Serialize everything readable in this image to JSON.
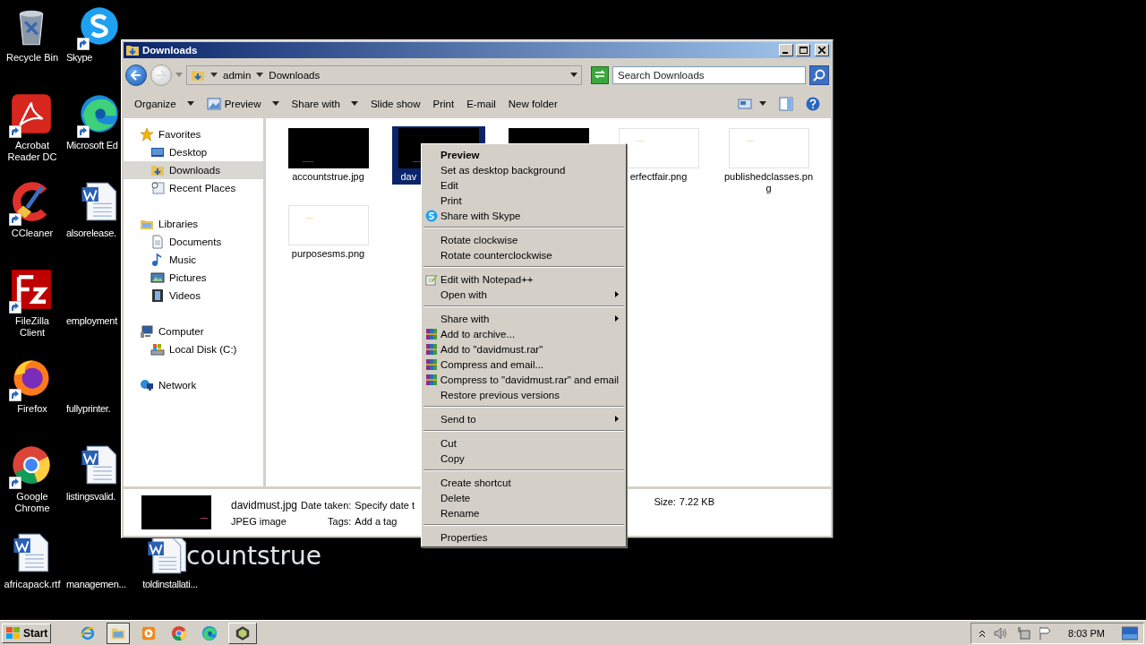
{
  "desktop": {
    "columns": [
      [
        {
          "label": "Recycle Bin",
          "kind": "recycle",
          "shortcut": false
        },
        {
          "label": "Acrobat Reader DC",
          "kind": "acrobat",
          "shortcut": true
        },
        {
          "label": "CCleaner",
          "kind": "ccleaner",
          "shortcut": true
        },
        {
          "label": "FileZilla Client",
          "kind": "filezilla",
          "shortcut": true
        },
        {
          "label": "Firefox",
          "kind": "firefox",
          "shortcut": true
        },
        {
          "label": "Google Chrome",
          "kind": "chrome",
          "shortcut": true
        },
        {
          "label": "africapack.rtf",
          "kind": "word",
          "shortcut": false
        }
      ],
      [
        {
          "label": "Skype",
          "kind": "skype",
          "shortcut": true
        },
        {
          "label": "Microsoft Ed",
          "kind": "edge",
          "shortcut": true
        },
        {
          "label": "alsorelease.",
          "kind": "word",
          "shortcut": false
        },
        {
          "label": "employment",
          "kind": "none",
          "shortcut": false
        },
        {
          "label": "fullyprinter.",
          "kind": "none",
          "shortcut": false
        },
        {
          "label": "listingsvalid.",
          "kind": "word",
          "shortcut": false
        },
        {
          "label": "managemen...",
          "kind": "none",
          "shortcut": false
        }
      ],
      [
        {
          "label": "toldinstallati...",
          "kind": "word",
          "shortcut": false
        }
      ]
    ],
    "drag_ghost": {
      "label": "countstrue",
      "kind": "word"
    }
  },
  "explorer": {
    "title": "Downloads",
    "breadcrumb": [
      "admin",
      "Downloads"
    ],
    "search": {
      "placeholder": "Search Downloads"
    },
    "toolbar": [
      {
        "label": "Organize",
        "kind": "text",
        "dropdown": true
      },
      {
        "label": "Preview",
        "kind": "preview",
        "dropdown": true
      },
      {
        "label": "Share with",
        "kind": "text",
        "dropdown": true
      },
      {
        "label": "Slide show",
        "kind": "text",
        "dropdown": false
      },
      {
        "label": "Print",
        "kind": "text",
        "dropdown": false
      },
      {
        "label": "E-mail",
        "kind": "text",
        "dropdown": false
      },
      {
        "label": "New folder",
        "kind": "text",
        "dropdown": false
      }
    ],
    "nav": [
      {
        "label": "Favorites",
        "kind": "star",
        "children": [
          {
            "label": "Desktop",
            "kind": "desktop",
            "selected": false
          },
          {
            "label": "Downloads",
            "kind": "downloads",
            "selected": true
          },
          {
            "label": "Recent Places",
            "kind": "recent",
            "selected": false
          }
        ]
      },
      {
        "label": "Libraries",
        "kind": "library",
        "children": [
          {
            "label": "Documents",
            "kind": "document",
            "selected": false
          },
          {
            "label": "Music",
            "kind": "music",
            "selected": false
          },
          {
            "label": "Pictures",
            "kind": "pictures",
            "selected": false
          },
          {
            "label": "Videos",
            "kind": "videos",
            "selected": false
          }
        ]
      },
      {
        "label": "Computer",
        "kind": "computer",
        "children": [
          {
            "label": "Local Disk (C:)",
            "kind": "disk",
            "selected": false
          }
        ]
      },
      {
        "label": "Network",
        "kind": "network"
      }
    ],
    "files": [
      {
        "name": "accountstrue.jpg",
        "kind": "dark",
        "selected": false
      },
      {
        "name": "dav",
        "kind": "dark",
        "selected": true
      },
      {
        "kind": "dark",
        "selected": false
      },
      {
        "name": "erfectfair.png",
        "kind": "light",
        "selected": false
      },
      {
        "name": "publishedclasses.png",
        "kind": "light",
        "selected": false
      },
      {
        "name": "purposesms.png",
        "kind": "light",
        "selected": false
      }
    ],
    "details": {
      "name": "davidmust.jpg",
      "type": "JPEG image",
      "date_label": "Date taken:",
      "date_value": "Specify date t",
      "tags_label": "Tags:",
      "tags_value": "Add a tag",
      "size_label": "Size:",
      "size_value": "7.22 KB"
    }
  },
  "context_menu": {
    "groups": [
      [
        {
          "label": "Preview",
          "default": true,
          "kind": "plain",
          "submenu": false
        },
        {
          "label": "Set as desktop background",
          "default": false,
          "kind": "plain",
          "submenu": false
        },
        {
          "label": "Edit",
          "default": false,
          "kind": "plain",
          "submenu": false
        },
        {
          "label": "Print",
          "default": false,
          "kind": "plain",
          "submenu": false
        },
        {
          "label": "Share with Skype",
          "default": false,
          "kind": "skype",
          "submenu": false
        }
      ],
      [
        {
          "label": "Rotate clockwise",
          "default": false,
          "kind": "plain",
          "submenu": false
        },
        {
          "label": "Rotate counterclockwise",
          "default": false,
          "kind": "plain",
          "submenu": false
        }
      ],
      [
        {
          "label": "Edit with Notepad++",
          "default": false,
          "kind": "notepad",
          "submenu": false
        },
        {
          "label": "Open with",
          "default": false,
          "kind": "plain",
          "submenu": true
        }
      ],
      [
        {
          "label": "Share with",
          "default": false,
          "kind": "plain",
          "submenu": true
        },
        {
          "label": "Add to archive...",
          "default": false,
          "kind": "winrar",
          "submenu": false
        },
        {
          "label": "Add to \"davidmust.rar\"",
          "default": false,
          "kind": "winrar",
          "submenu": false
        },
        {
          "label": "Compress and email...",
          "default": false,
          "kind": "winrar",
          "submenu": false
        },
        {
          "label": "Compress to \"davidmust.rar\" and email",
          "default": false,
          "kind": "winrar",
          "submenu": false
        },
        {
          "label": "Restore previous versions",
          "default": false,
          "kind": "plain",
          "submenu": false
        }
      ],
      [
        {
          "label": "Send to",
          "default": false,
          "kind": "plain",
          "submenu": true
        }
      ],
      [
        {
          "label": "Cut",
          "default": false,
          "kind": "plain",
          "submenu": false
        },
        {
          "label": "Copy",
          "default": false,
          "kind": "plain",
          "submenu": false
        }
      ],
      [
        {
          "label": "Create shortcut",
          "default": false,
          "kind": "plain",
          "submenu": false
        },
        {
          "label": "Delete",
          "default": false,
          "kind": "plain",
          "submenu": false
        },
        {
          "label": "Rename",
          "default": false,
          "kind": "plain",
          "submenu": false
        }
      ],
      [
        {
          "label": "Properties",
          "default": false,
          "kind": "plain",
          "submenu": false
        }
      ]
    ]
  },
  "taskbar": {
    "start": "Start",
    "apps": [
      {
        "kind": "ie",
        "active": false
      },
      {
        "kind": "explorer",
        "active": true
      },
      {
        "kind": "media",
        "active": false
      },
      {
        "kind": "chrome",
        "active": false
      },
      {
        "kind": "edge",
        "active": false
      },
      {
        "kind": "box",
        "active": false
      }
    ],
    "tray": {
      "time": "8:03 PM"
    }
  }
}
